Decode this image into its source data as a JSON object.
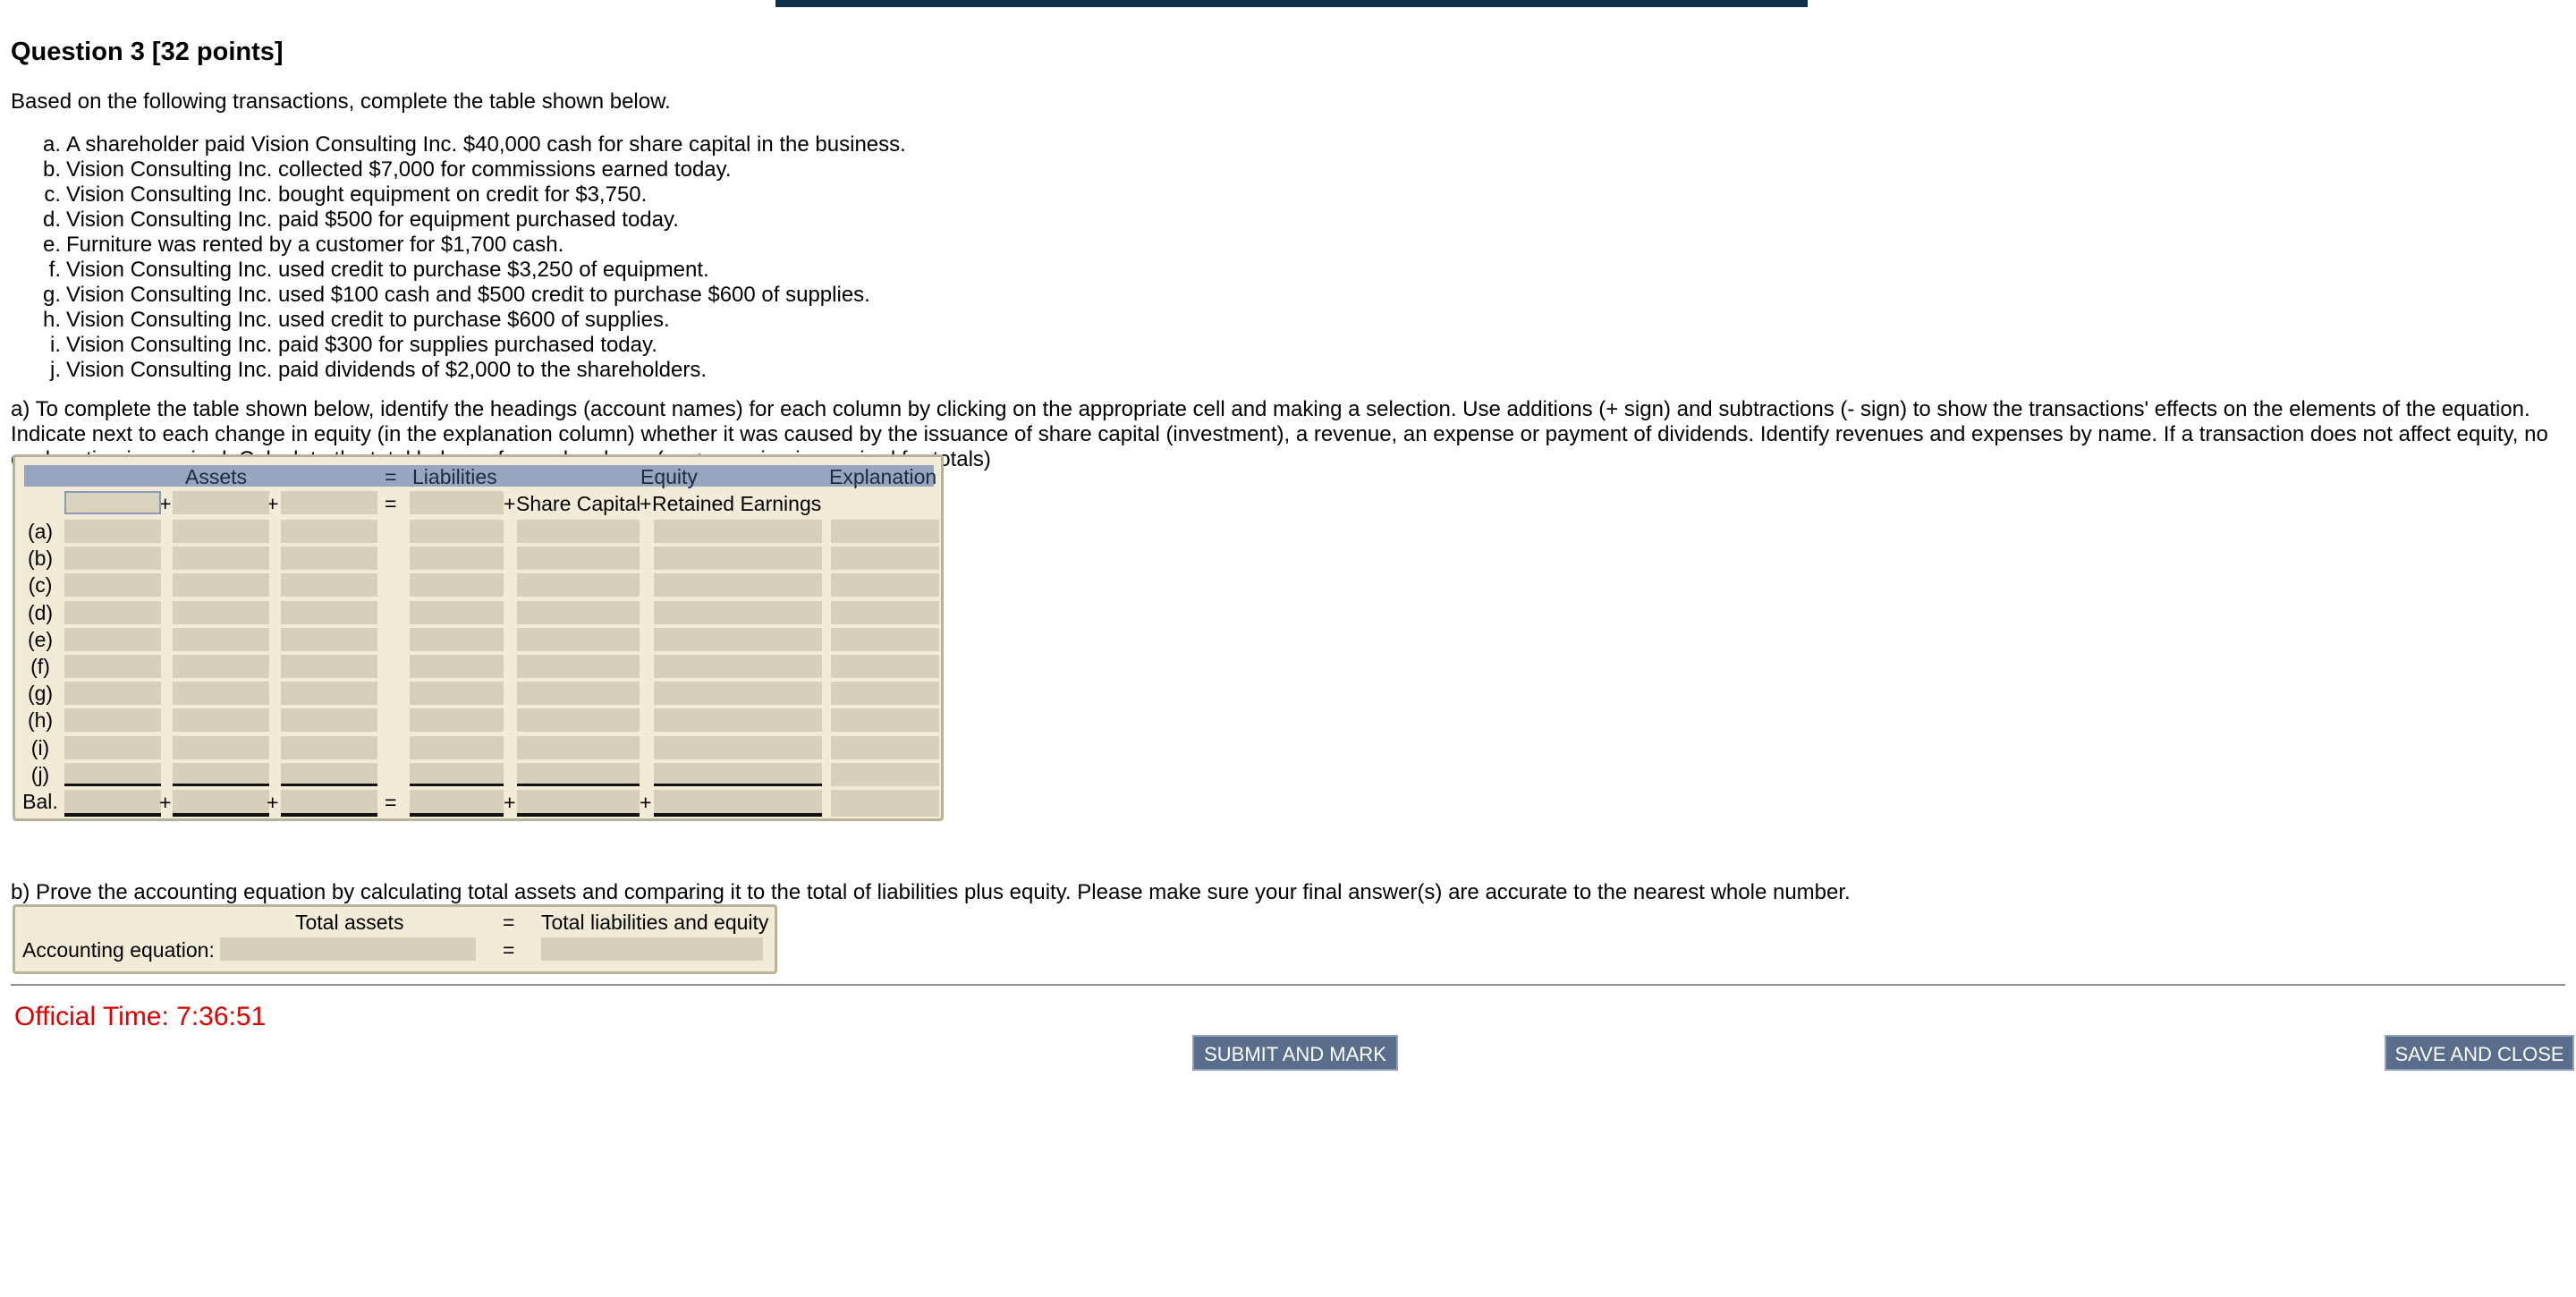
{
  "question": {
    "title": "Question 3 [32 points]",
    "intro": "Based on the following transactions, complete the table shown below."
  },
  "transactions": [
    {
      "letter": "a.",
      "text": "A shareholder paid Vision Consulting Inc. $40,000 cash for share capital in the business."
    },
    {
      "letter": "b.",
      "text": "Vision Consulting Inc. collected $7,000 for commissions earned today."
    },
    {
      "letter": "c.",
      "text": "Vision Consulting Inc. bought equipment on credit for $3,750."
    },
    {
      "letter": "d.",
      "text": "Vision Consulting Inc. paid $500 for equipment purchased today."
    },
    {
      "letter": "e.",
      "text": "Furniture was rented by a customer for $1,700 cash."
    },
    {
      "letter": "f.",
      "text": "Vision Consulting Inc. used credit to purchase $3,250 of equipment."
    },
    {
      "letter": "g.",
      "text": "Vision Consulting Inc. used $100 cash and $500 credit to purchase $600 of supplies."
    },
    {
      "letter": "h.",
      "text": "Vision Consulting Inc. used credit to purchase $600 of supplies."
    },
    {
      "letter": "i.",
      "text": "Vision Consulting Inc. paid $300 for supplies purchased today."
    },
    {
      "letter": "j.",
      "text": "Vision Consulting Inc. paid dividends of $2,000 to the shareholders."
    }
  ],
  "part_a": {
    "instructions": "a) To complete the table shown below, identify the headings (account names) for each column by clicking on the appropriate cell and making a selection. Use additions (+ sign) and subtractions (- sign) to show the transactions' effects on the elements of the equation. Indicate next to each change in equity (in the explanation column) whether it was caused by the issuance of share capital (investment), a revenue, an expense or payment of dividends. Identify revenues and expenses by name. If a transaction does not affect equity, no explanation is required. Calculate the total balance for each column (no + or - sign is required for totals)",
    "headers": {
      "assets": "Assets",
      "equals": "=",
      "liabilities": "Liabilities",
      "equity": "Equity",
      "explanation": "Explanation"
    },
    "subheaders": {
      "share_capital": "Share Capital",
      "retained_earnings": "Retained Earnings",
      "plus": "+",
      "equals": "="
    },
    "rows": [
      "(a)",
      "(b)",
      "(c)",
      "(d)",
      "(e)",
      "(f)",
      "(g)",
      "(h)",
      "(i)",
      "(j)"
    ],
    "balance_label": "Bal."
  },
  "part_b": {
    "instructions": "b) Prove the accounting equation by calculating total assets and comparing it to the total of liabilities plus equity. Please make sure your final answer(s) are accurate to the nearest whole number.",
    "total_assets": "Total assets",
    "equals": "=",
    "total_liab_equity": "Total liabilities and equity",
    "row_label": "Accounting equation:"
  },
  "footer": {
    "timer": "Official Time: 7:36:51",
    "submit": "SUBMIT AND MARK",
    "save": "SAVE AND CLOSE"
  },
  "colors": {
    "panel": "#f1ebd7",
    "input": "#d6d0bb",
    "header_bar": "#97a5bf",
    "button": "#5a6d8c",
    "timer": "#e00000"
  }
}
